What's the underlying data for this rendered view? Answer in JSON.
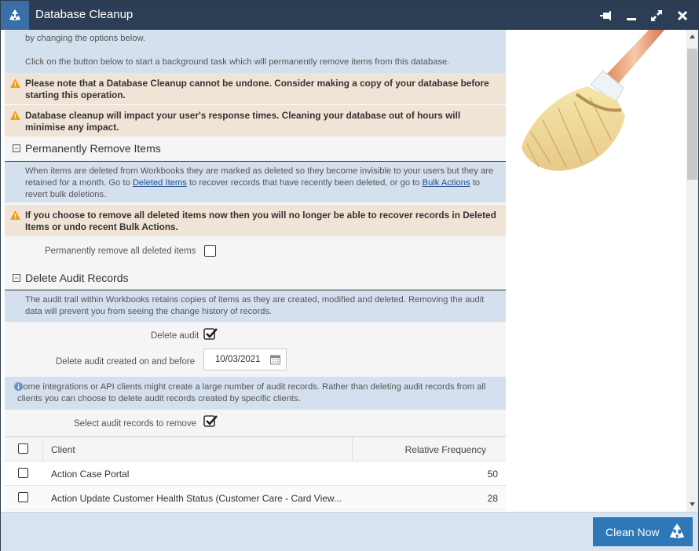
{
  "window": {
    "title": "Database Cleanup"
  },
  "intro": {
    "partial_line": "by changing the options below.",
    "start_text": "Click on the button below to start a background task which will permanently remove items from this database."
  },
  "warnings": {
    "cannot_undo": "Please note that a Database Cleanup cannot be undone. Consider making a copy of your database before starting this operation.",
    "response_times": "Database cleanup will impact your user's response times. Cleaning your database out of hours will minimise any impact."
  },
  "remove_items": {
    "heading": "Permanently Remove Items",
    "info_before": "When items are deleted from Workbooks they are marked as deleted so they become invisible to your users but they are retained for a month. Go to",
    "link_deleted": "Deleted Items",
    "info_middle": "to recover records that have recently been deleted, or go to",
    "link_bulk": "Bulk Actions",
    "info_after": "to revert bulk deletions.",
    "warning": "If you choose to remove all deleted items now then you will no longer be able to recover records in Deleted Items or undo recent Bulk Actions.",
    "checkbox_label": "Permanently remove all deleted items"
  },
  "audit": {
    "heading": "Delete Audit Records",
    "info": "The audit trail within Workbooks retains copies of items as they are created, modified and deleted. Removing the audit data will prevent you from seeing the change history of records.",
    "delete_label": "Delete audit",
    "delete_checked": true,
    "date_label": "Delete audit created on and before",
    "date_value": "10/03/2021",
    "clients_info": "Some integrations or API clients might create a large number of audit records. Rather than deleting audit records from all clients you can choose to delete audit records created by specific clients.",
    "select_label": "Select audit records to remove",
    "select_checked": true
  },
  "grid": {
    "columns": [
      "Client",
      "Relative Frequency"
    ],
    "rows": [
      {
        "client": "Action Case Portal",
        "frequency": "50"
      },
      {
        "client": "Action Update Customer Health Status (Customer Care - Card View...",
        "frequency": "28"
      }
    ]
  },
  "footer": {
    "clean_label": "Clean Now"
  },
  "colors": {
    "titlebar": "#2c3e55",
    "accent": "#2e78b8",
    "info_bg": "#d5e0ee",
    "warn_bg": "#f0e4d6"
  }
}
